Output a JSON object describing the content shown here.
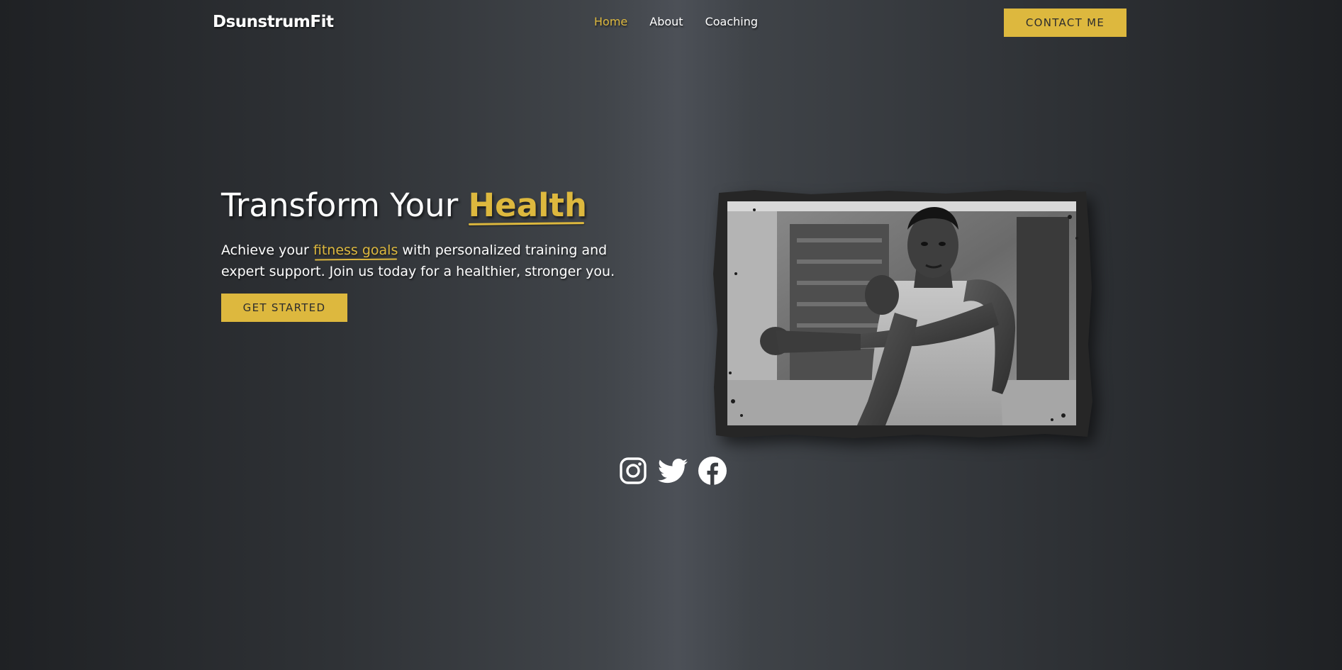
{
  "header": {
    "brand": "DsunstrumFit",
    "nav": [
      {
        "label": "Home",
        "active": true
      },
      {
        "label": "About",
        "active": false
      },
      {
        "label": "Coaching",
        "active": false
      }
    ],
    "contact_label": "CONTACT ME"
  },
  "hero": {
    "title_prefix": "Transform Your ",
    "title_accent": "Health",
    "text_part1": "Achieve your ",
    "text_highlight": "fitness goals",
    "text_part2": " with personalized training and expert support. Join us today for a healthier, stronger you.",
    "cta_label": "GET STARTED"
  },
  "image": {
    "subject": "athlete-stretching-photo",
    "style": "grayscale, grunge frame"
  },
  "social": {
    "icons": [
      "instagram-icon",
      "twitter-icon",
      "facebook-icon"
    ]
  },
  "colors": {
    "accent": "#ddb83e",
    "text": "#ffffff",
    "button_text": "#2d2d2d",
    "background_dark": "#1f2124",
    "background_light": "#4c5057"
  }
}
